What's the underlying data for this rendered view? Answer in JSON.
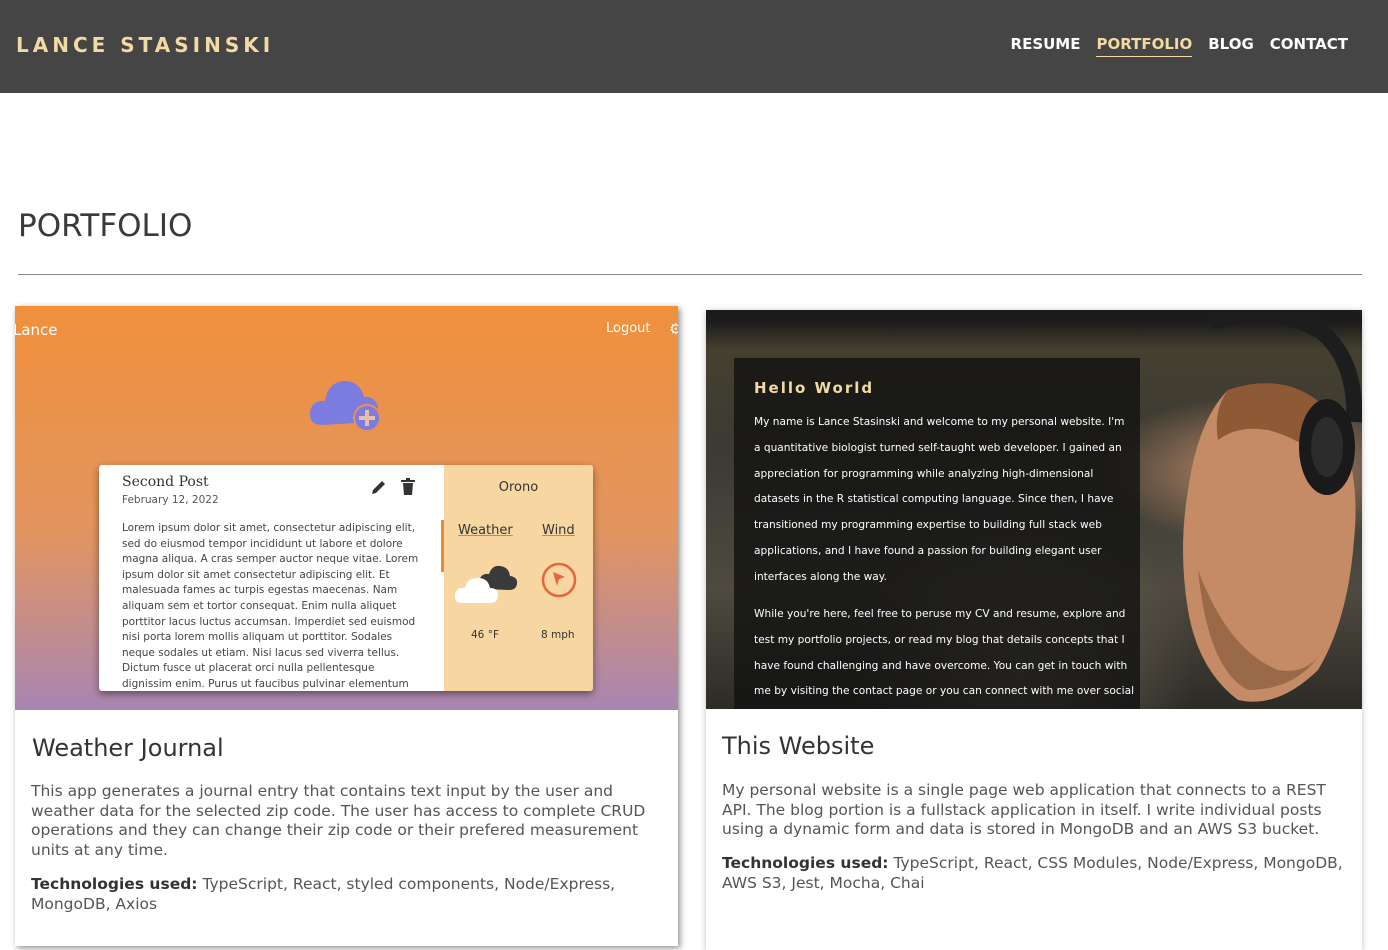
{
  "header": {
    "brand": "LANCE STASINSKI",
    "nav": [
      "RESUME",
      "PORTFOLIO",
      "BLOG",
      "CONTACT"
    ],
    "active": "PORTFOLIO"
  },
  "page": {
    "title": "PORTFOLIO"
  },
  "projects": [
    {
      "title": "Weather Journal",
      "description": "This app generates a journal entry that contains text input by the user and weather data for the selected zip code. The user has access to complete CRUD operations and they can change their zip code or their prefered measurement units at any time.",
      "tech_label": "Technologies used:",
      "tech": "TypeScript, React, styled components, Node/Express, MongoDB, Axios",
      "screenshot": {
        "app_name": "Lance",
        "logout": "Logout",
        "post_title": "Second Post",
        "post_date": "February 12, 2022",
        "post_body": "Lorem ipsum dolor sit amet, consectetur adipiscing elit, sed do eiusmod tempor incididunt ut labore et dolore magna aliqua. A cras semper auctor neque vitae. Lorem ipsum dolor sit amet consectetur adipiscing elit. Et malesuada fames ac turpis egestas maecenas. Nam aliquam sem et tortor consequat. Enim nulla aliquet porttitor lacus luctus accumsan. Imperdiet sed euismod nisi porta lorem mollis aliquam ut porttitor. Sodales neque sodales ut etiam. Nisi lacus sed viverra tellus. Dictum fusce ut placerat orci nulla pellentesque dignissim enim. Purus ut faucibus pulvinar elementum",
        "location": "Orono",
        "tab_weather": "Weather",
        "tab_wind": "Wind",
        "temperature": "46 °F",
        "wind_speed": "8 mph",
        "icons": [
          "cloud-add-icon",
          "edit-icon",
          "trash-icon",
          "cloud-icon",
          "compass-icon",
          "gear-icon"
        ],
        "colors": {
          "gradient_top": "#ef903b",
          "gradient_bottom": "#a886b2",
          "accent": "#7b7be0",
          "panel": "#f7d6a2"
        }
      }
    },
    {
      "title": "This Website",
      "description": "My personal website is a single page web application that connects to a REST API. The blog portion is a fullstack application in itself. I write individual posts using a dynamic form and data is stored in MongoDB and an AWS S3 bucket.",
      "tech_label": "Technologies used:",
      "tech": "TypeScript, React, CSS Modules, Node/Express, MongoDB, AWS S3, Jest, Mocha, Chai",
      "screenshot": {
        "heading": "Hello World",
        "paragraph1": "My name is Lance Stasinski and welcome to my personal website. I'm a quantitative biologist turned self-taught web developer. I gained an appreciation for programming while analyzing high-dimensional datasets in the R statistical computing language. Since then, I have transitioned my programming expertise to building full stack web applications, and I have found a passion for building elegant user interfaces along the way.",
        "paragraph2": "While you're here, feel free to peruse my CV and resume, explore and test my portfolio projects, or read my blog that details concepts that I have found challenging and have overcome. You can get in touch with me by visiting the contact page or you can connect with me over social"
      }
    }
  ],
  "colors": {
    "header_bg": "#454545",
    "brand": "#f3d9a4",
    "active_nav": "#f3d9a4"
  }
}
